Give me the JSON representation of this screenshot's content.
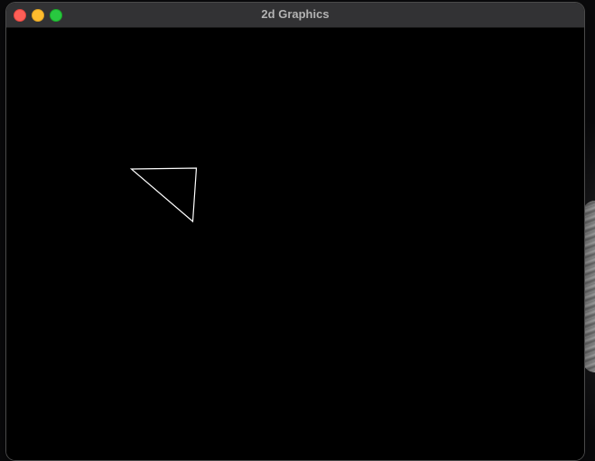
{
  "window": {
    "title": "2d Graphics"
  },
  "canvas": {
    "background": "#000000",
    "shapes": [
      {
        "type": "triangle",
        "stroke": "#ffffff",
        "fill": "none"
      }
    ]
  },
  "colors": {
    "close": "#fe5f57",
    "minimize": "#febc2e",
    "zoom": "#28c840",
    "titlebar": "#323234",
    "title_text": "#b3b3b3"
  }
}
